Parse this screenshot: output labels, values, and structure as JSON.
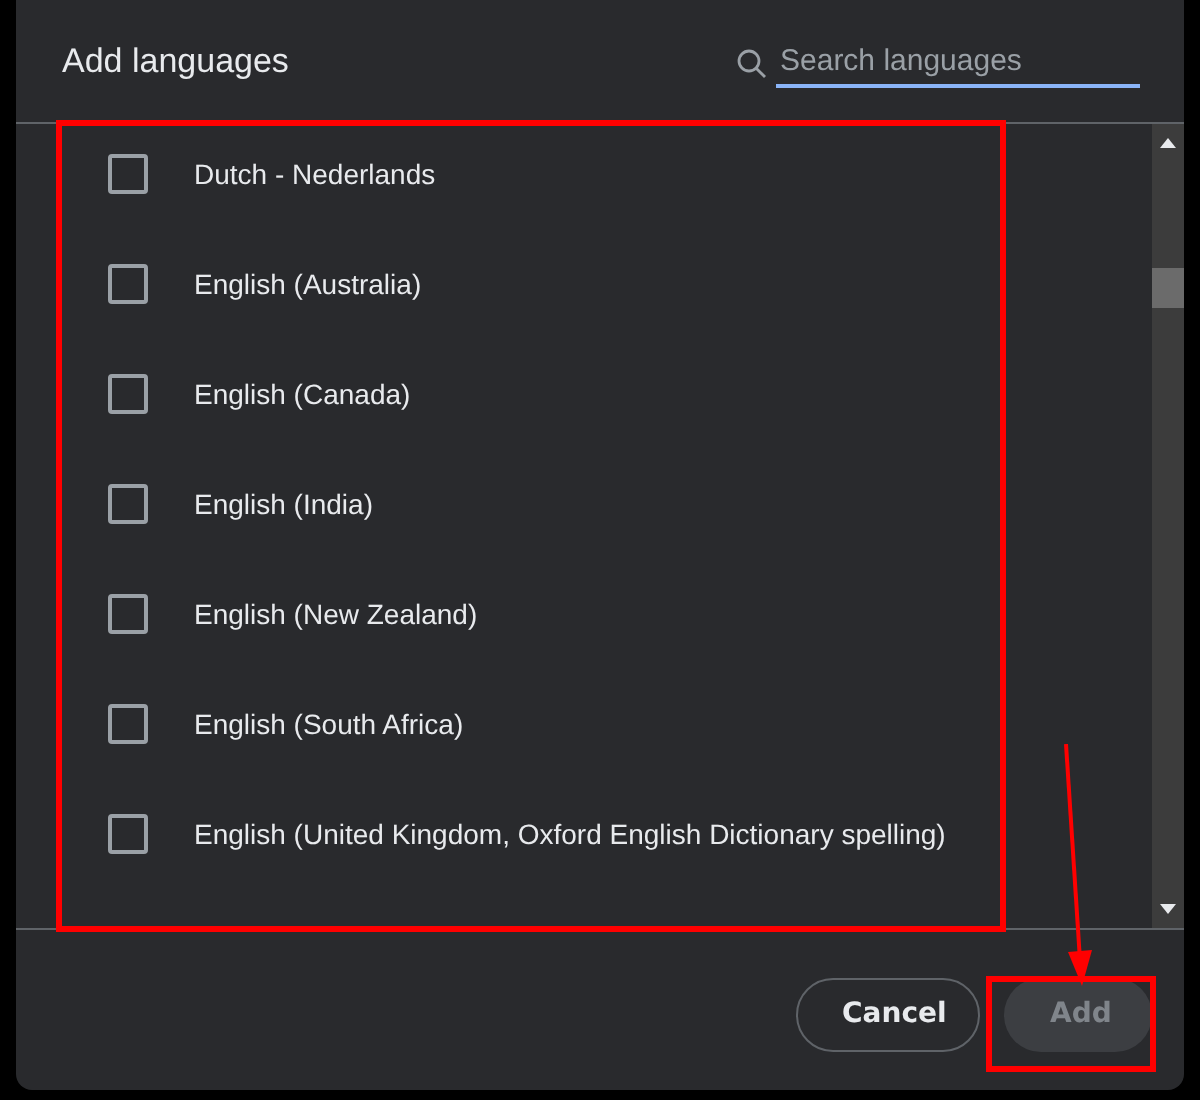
{
  "dialog": {
    "title": "Add languages"
  },
  "search": {
    "placeholder": "Search languages"
  },
  "languages": [
    {
      "label": "Dutch - Nederlands",
      "checked": false
    },
    {
      "label": "English (Australia)",
      "checked": false
    },
    {
      "label": "English (Canada)",
      "checked": false
    },
    {
      "label": "English (India)",
      "checked": false
    },
    {
      "label": "English (New Zealand)",
      "checked": false
    },
    {
      "label": "English (South Africa)",
      "checked": false
    },
    {
      "label": "English (United Kingdom, Oxford English Dictionary spelling)",
      "checked": false
    }
  ],
  "buttons": [
    {
      "label": "Cancel",
      "kind": "secondary",
      "disabled": false
    },
    {
      "label": "Add",
      "kind": "primary",
      "disabled": true
    }
  ]
}
